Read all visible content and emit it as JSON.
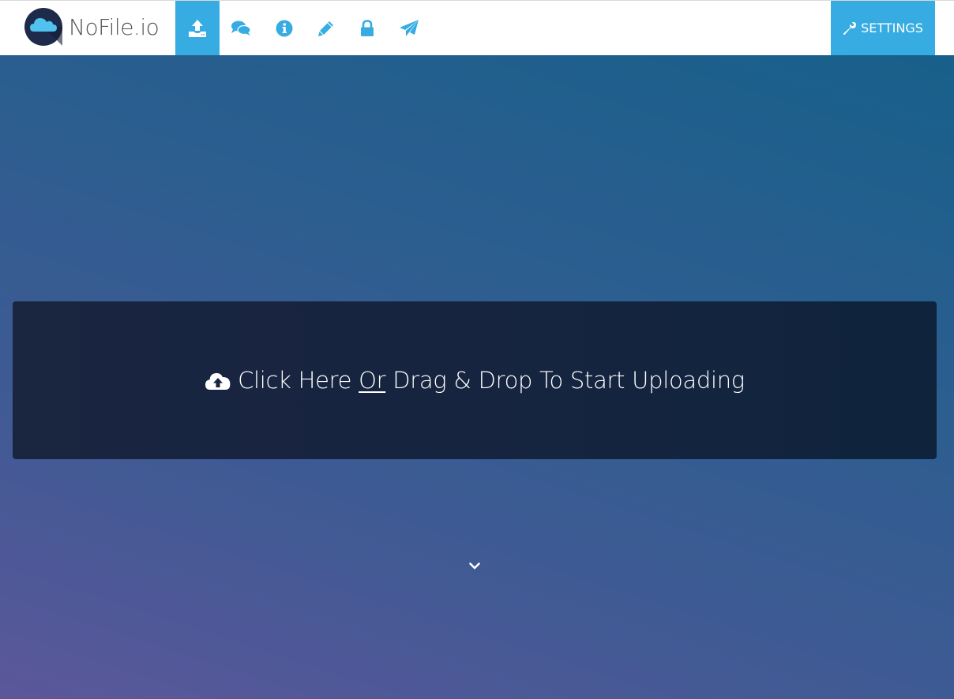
{
  "brand": {
    "name": "NoFile.io"
  },
  "colors": {
    "accent": "#36ace2",
    "dropzone_bg": "#15243f",
    "text_on_dark": "#ffffff",
    "logo_text": "#555555"
  },
  "nav": {
    "items": [
      {
        "icon": "upload-icon",
        "active": true
      },
      {
        "icon": "chat-icon",
        "active": false
      },
      {
        "icon": "info-icon",
        "active": false
      },
      {
        "icon": "pencil-icon",
        "active": false
      },
      {
        "icon": "lock-icon",
        "active": false
      },
      {
        "icon": "paper-plane-icon",
        "active": false
      }
    ],
    "settings": {
      "label": "SETTINGS",
      "icon": "wrench-icon"
    }
  },
  "dropzone": {
    "icon": "cloud-upload-icon",
    "text_before": "Click Here",
    "or": "Or",
    "text_after": "Drag & Drop To Start Uploading"
  },
  "scroll": {
    "icon": "chevron-down-icon"
  }
}
